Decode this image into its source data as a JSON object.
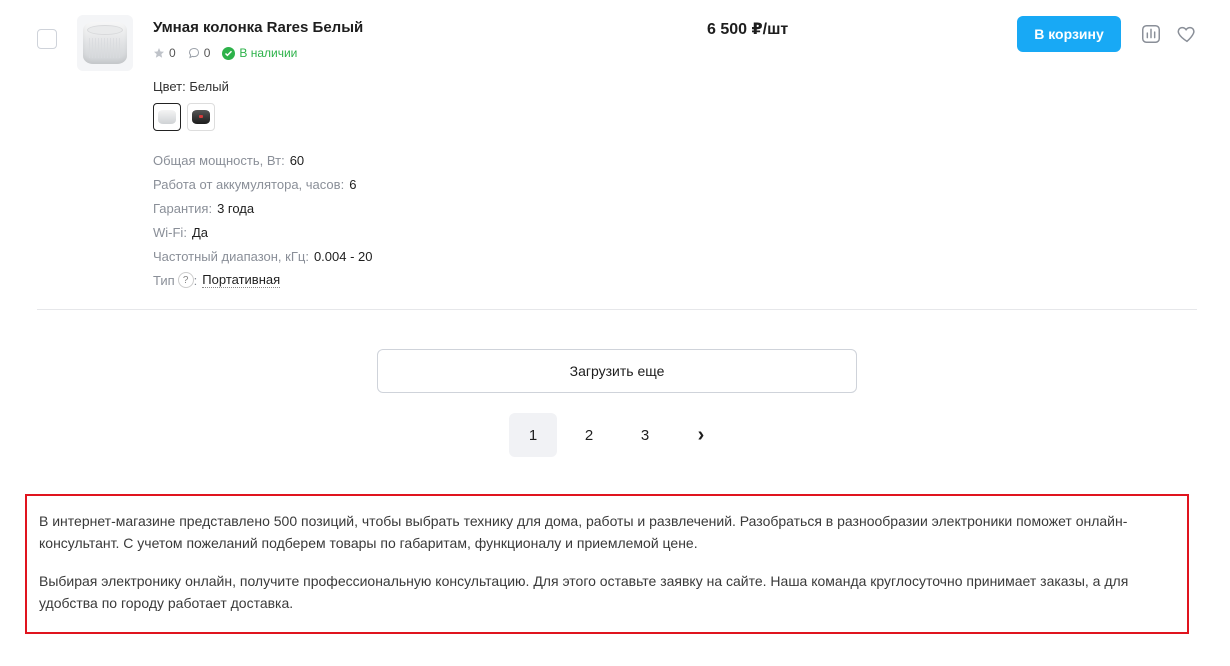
{
  "product": {
    "name": "Умная колонка Rares Белый",
    "rating": "0",
    "comments": "0",
    "stock": "В наличии",
    "color_label": "Цвет: Белый",
    "price": "6 500 ₽/шт",
    "cart_label": "В корзину",
    "specs": [
      {
        "key": "Общая мощность, Вт",
        "value": "60"
      },
      {
        "key": "Работа от аккумулятора, часов",
        "value": "6"
      },
      {
        "key": "Гарантия",
        "value": "3 года"
      },
      {
        "key": "Wi-Fi",
        "value": "Да"
      },
      {
        "key": "Частотный диапазон, кГц",
        "value": "0.004 - 20"
      },
      {
        "key": "Тип",
        "value": "Портативная",
        "help": "?"
      }
    ]
  },
  "load_more_label": "Загрузить еще",
  "pagination": {
    "pages": [
      "1",
      "2",
      "3"
    ],
    "active": "1",
    "next": "›"
  },
  "seo": {
    "p1": "В интернет-магазине представлено 500 позиций, чтобы выбрать технику для дома, работы и развлечений. Разобраться в разнообразии электроники поможет онлайн-консультант. С учетом пожеланий подберем товары по габаритам, функционалу и приемлемой цене.",
    "p2": "Выбирая электронику онлайн, получите профессиональную консультацию. Для этого оставьте заявку на сайте. Наша команда круглосуточно принимает заказы, а для удобства по городу работает доставка."
  },
  "colors": {
    "accent": "#18a9f5",
    "in_stock": "#2db24a",
    "highlight_border": "#e0141e"
  },
  "icons": [
    "star-icon",
    "comment-icon",
    "check-icon",
    "compare-icon",
    "heart-icon",
    "chevron-right-icon"
  ]
}
